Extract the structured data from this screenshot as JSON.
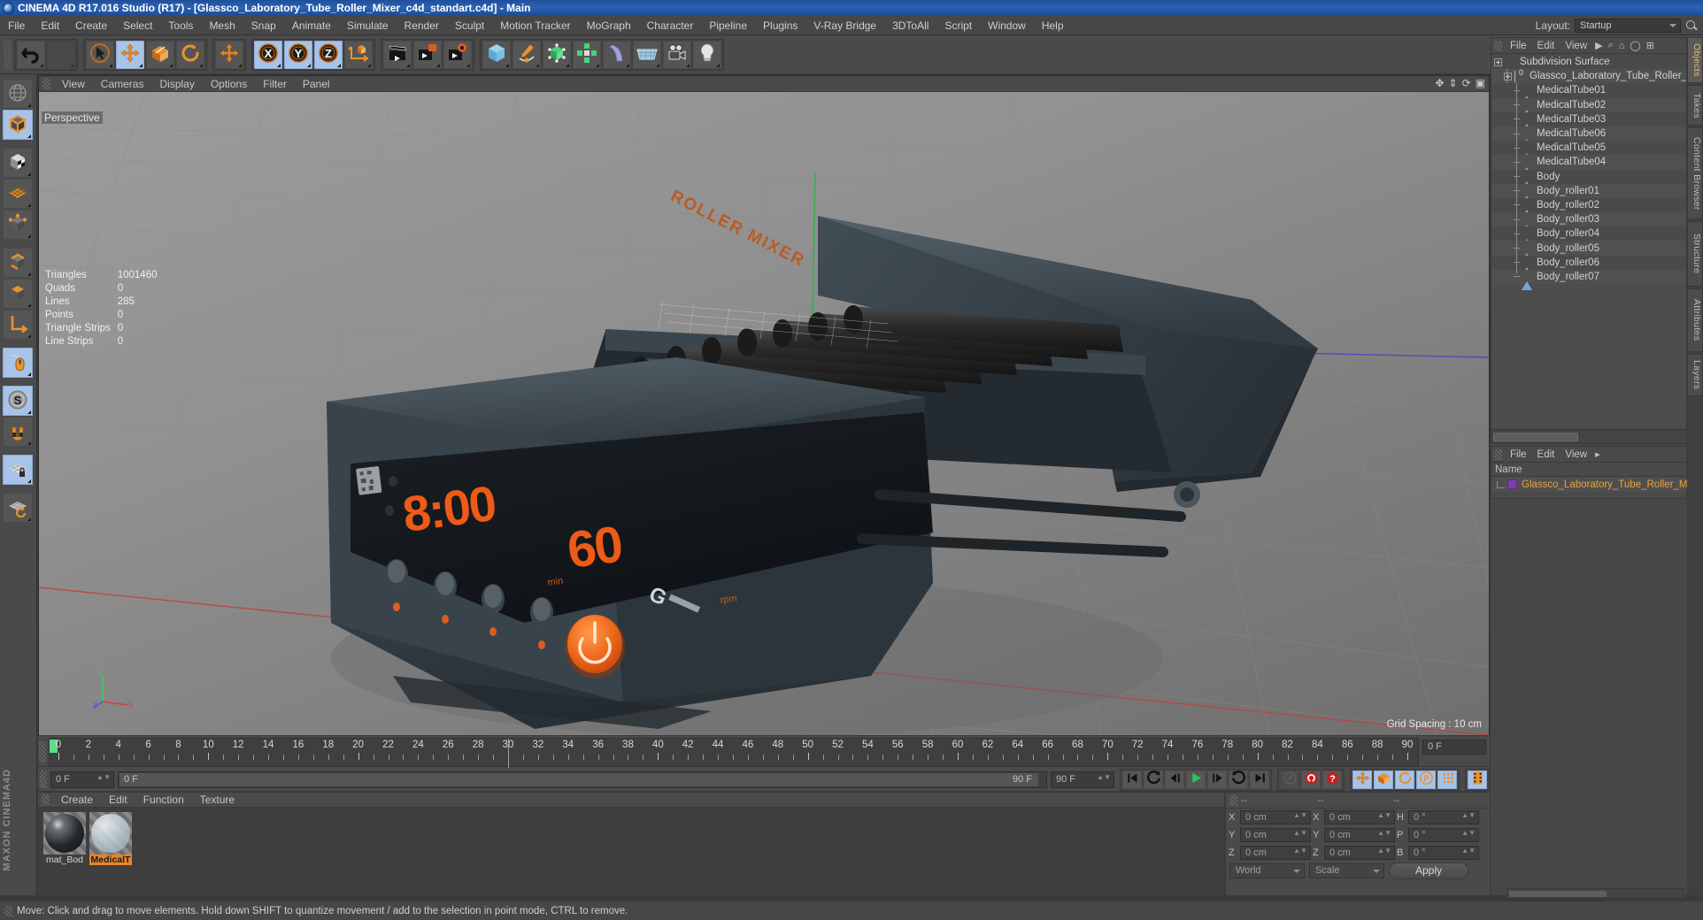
{
  "app": {
    "title": "CINEMA 4D R17.016 Studio (R17) - [Glassco_Laboratory_Tube_Roller_Mixer_c4d_standart.c4d] - Main",
    "logo_icon": "c4d-logo-icon"
  },
  "menubar": {
    "items": [
      "File",
      "Edit",
      "Create",
      "Select",
      "Tools",
      "Mesh",
      "Snap",
      "Animate",
      "Simulate",
      "Render",
      "Sculpt",
      "Motion Tracker",
      "MoGraph",
      "Character",
      "Pipeline",
      "Plugins",
      "V-Ray Bridge",
      "3DToAll",
      "Script",
      "Window",
      "Help"
    ],
    "layout_label": "Layout:",
    "layout_value": "Startup",
    "search_icon": "search-icon"
  },
  "toolbar": {
    "groups": [
      {
        "name": "history",
        "buttons": [
          {
            "name": "undo-button",
            "icon": "undo-arrow-icon",
            "state": "normal"
          },
          {
            "name": "redo-button",
            "icon": "redo-arrow-icon",
            "state": "disabled"
          }
        ]
      },
      {
        "name": "transform",
        "buttons": [
          {
            "name": "live-selection-tool",
            "icon": "cursor-select-icon",
            "state": "normal"
          },
          {
            "name": "move-tool",
            "icon": "move-arrows-icon",
            "state": "active"
          },
          {
            "name": "scale-tool",
            "icon": "scale-box-icon",
            "state": "normal"
          },
          {
            "name": "rotate-tool",
            "icon": "rotate-circle-icon",
            "state": "normal"
          }
        ]
      },
      {
        "name": "move-duplicate",
        "buttons": [
          {
            "name": "move-tool-secondary",
            "icon": "move-arrows-icon",
            "state": "normal"
          }
        ]
      },
      {
        "name": "axis-locks",
        "buttons": [
          {
            "name": "lock-x-axis",
            "icon": "axis-x-icon",
            "state": "active",
            "label": "X"
          },
          {
            "name": "lock-y-axis",
            "icon": "axis-y-icon",
            "state": "active",
            "label": "Y"
          },
          {
            "name": "lock-z-axis",
            "icon": "axis-z-icon",
            "state": "active",
            "label": "Z"
          },
          {
            "name": "world-object-coords",
            "icon": "world-axis-icon",
            "state": "normal"
          }
        ]
      },
      {
        "name": "render",
        "buttons": [
          {
            "name": "render-view-button",
            "icon": "render-clapboard-icon",
            "state": "normal"
          },
          {
            "name": "render-to-picture-viewer",
            "icon": "render-picture-icon",
            "state": "normal"
          },
          {
            "name": "render-settings",
            "icon": "render-gear-icon",
            "state": "normal"
          }
        ]
      },
      {
        "name": "create",
        "buttons": [
          {
            "name": "add-cube-primitive",
            "icon": "cube-icon",
            "state": "normal"
          },
          {
            "name": "add-spline",
            "icon": "pen-spline-icon",
            "state": "normal"
          },
          {
            "name": "add-generator",
            "icon": "generator-cage-icon",
            "state": "normal"
          },
          {
            "name": "add-modeling-object",
            "icon": "array-clone-icon",
            "state": "normal"
          },
          {
            "name": "add-deformer",
            "icon": "bend-deformer-icon",
            "state": "normal"
          },
          {
            "name": "add-environment",
            "icon": "floor-grid-icon",
            "state": "normal"
          },
          {
            "name": "add-camera",
            "icon": "camera-icon",
            "state": "normal"
          },
          {
            "name": "add-light",
            "icon": "light-bulb-icon",
            "state": "normal"
          }
        ]
      }
    ]
  },
  "left_toolbar": {
    "buttons": [
      {
        "name": "undo-view-tool",
        "icon": "globe-wire-icon",
        "state": "normal"
      },
      {
        "name": "make-editable",
        "icon": "make-editable-cube-icon",
        "state": "active"
      },
      {
        "name": "texture-mode",
        "icon": "texture-checker-cube-icon",
        "state": "normal"
      },
      {
        "name": "uv-mesh-mode",
        "icon": "uv-grid-icon",
        "state": "normal"
      },
      {
        "name": "points-mode",
        "icon": "points-cube-icon",
        "state": "normal"
      },
      {
        "name": "edges-mode",
        "icon": "edges-cube-icon",
        "state": "normal"
      },
      {
        "name": "polygons-mode",
        "icon": "polygons-cube-icon",
        "state": "normal"
      },
      {
        "name": "object-axis-mode",
        "icon": "axis-L-icon",
        "state": "normal"
      },
      {
        "name": "enable-snap-mouse",
        "icon": "mouse-icon",
        "state": "active"
      },
      {
        "name": "snap-settings",
        "icon": "snap-S-icon",
        "state": "active"
      },
      {
        "name": "magnet-tool",
        "icon": "magnet-icon",
        "state": "normal"
      },
      {
        "name": "workplane-lock",
        "icon": "workplane-lock-icon",
        "state": "active"
      },
      {
        "name": "workplane-rotate",
        "icon": "workplane-rotate-icon",
        "state": "normal"
      }
    ]
  },
  "viewport": {
    "menu": [
      "View",
      "Cameras",
      "Display",
      "Options",
      "Filter",
      "Panel"
    ],
    "label": "Perspective",
    "grid_spacing": "Grid Spacing : 10 cm",
    "stats": [
      {
        "key": "Triangles",
        "value": "1001460"
      },
      {
        "key": "Quads",
        "value": "0"
      },
      {
        "key": "Lines",
        "value": "285"
      },
      {
        "key": "Points",
        "value": "0"
      },
      {
        "key": "Triangle Strips",
        "value": "0"
      },
      {
        "key": "Line Strips",
        "value": "0"
      }
    ],
    "axis_labels": {
      "x": "X",
      "y": "Y",
      "z": "Z"
    },
    "model": {
      "name": "Laboratory Tube Roller Mixer",
      "display_time": "8:00",
      "display_speed": "60",
      "brand_text": "ROLLER MIXER",
      "power_button": "power-icon",
      "accent_color": "#e8561e",
      "body_color": "#343c42"
    }
  },
  "timeline": {
    "tick_start": 0,
    "tick_end": 90,
    "tick_step": 2,
    "current_frame_label": "0 F",
    "start_field": "0 F",
    "slider_left_label": "0 F",
    "slider_right_label": "90 F",
    "end_field": "90 F",
    "playback_buttons": [
      {
        "name": "go-to-start-button",
        "icon": "skip-start-icon"
      },
      {
        "name": "previous-keyframe-button",
        "icon": "rewind-key-icon"
      },
      {
        "name": "step-back-button",
        "icon": "step-back-icon"
      },
      {
        "name": "play-button",
        "icon": "play-icon"
      },
      {
        "name": "step-forward-button",
        "icon": "step-forward-icon"
      },
      {
        "name": "next-keyframe-button",
        "icon": "forward-key-icon"
      },
      {
        "name": "go-to-end-button",
        "icon": "skip-end-icon"
      }
    ],
    "record_buttons": [
      {
        "name": "autokeying-toggle",
        "icon": "autokey-icon",
        "state": "disabled"
      },
      {
        "name": "record-active-objects",
        "icon": "record-circle-icon",
        "state": "normal"
      },
      {
        "name": "keyframe-selection",
        "icon": "keyframe-question-icon",
        "state": "normal"
      }
    ],
    "key_toggles": [
      {
        "name": "record-position-toggle",
        "icon": "position-arrows-icon",
        "state": "active"
      },
      {
        "name": "record-scale-toggle",
        "icon": "scale-icon",
        "state": "active"
      },
      {
        "name": "record-rotation-toggle",
        "icon": "rotation-icon",
        "state": "active"
      },
      {
        "name": "record-parameter-toggle",
        "icon": "parameter-P-icon",
        "state": "active"
      },
      {
        "name": "point-level-animation-toggle",
        "icon": "pla-dots-icon",
        "state": "active"
      }
    ],
    "extra_button": {
      "name": "timeline-settings-button",
      "icon": "film-strip-icon",
      "state": "active"
    }
  },
  "material_manager": {
    "menu": [
      "Create",
      "Edit",
      "Function",
      "Texture"
    ],
    "materials": [
      {
        "name": "mat_Bod",
        "selected": false,
        "color": "#2b2f33"
      },
      {
        "name": "MedicalT",
        "selected": true,
        "color": "#c9d4d8"
      }
    ]
  },
  "coordinates": {
    "header": [
      "--",
      "--",
      "--"
    ],
    "rows": [
      {
        "axis1": "X",
        "value1": "0 cm",
        "axis2": "X",
        "value2": "0 cm",
        "axis3": "H",
        "value3": "0 °"
      },
      {
        "axis1": "Y",
        "value1": "0 cm",
        "axis2": "Y",
        "value2": "0 cm",
        "axis3": "P",
        "value3": "0 °"
      },
      {
        "axis1": "Z",
        "value1": "0 cm",
        "axis2": "Z",
        "value2": "0 cm",
        "axis3": "B",
        "value3": "0 °"
      }
    ],
    "coord_system": "World",
    "size_mode": "Scale",
    "apply_label": "Apply"
  },
  "object_manager": {
    "menu": [
      "File",
      "Edit",
      "View"
    ],
    "icons": [
      "play-filter-icon",
      "search-icon",
      "home-icon",
      "ellipse-icon",
      "add-layer-icon"
    ],
    "tree": [
      {
        "label": "Subdivision Surface",
        "icon": "subdivision-surface-icon",
        "depth": 0,
        "expander": true
      },
      {
        "label": "Glassco_Laboratory_Tube_Roller_M",
        "icon": "null-object-icon",
        "depth": 1,
        "expander": true
      },
      {
        "label": "MedicalTube01",
        "icon": "polygon-object-icon",
        "depth": 2,
        "expander": false
      },
      {
        "label": "MedicalTube02",
        "icon": "polygon-object-icon",
        "depth": 2,
        "expander": false
      },
      {
        "label": "MedicalTube03",
        "icon": "polygon-object-icon",
        "depth": 2,
        "expander": false
      },
      {
        "label": "MedicalTube06",
        "icon": "polygon-object-icon",
        "depth": 2,
        "expander": false
      },
      {
        "label": "MedicalTube05",
        "icon": "polygon-object-icon",
        "depth": 2,
        "expander": false
      },
      {
        "label": "MedicalTube04",
        "icon": "polygon-object-icon",
        "depth": 2,
        "expander": false
      },
      {
        "label": "Body",
        "icon": "polygon-object-icon",
        "depth": 2,
        "expander": false
      },
      {
        "label": "Body_roller01",
        "icon": "polygon-object-icon",
        "depth": 2,
        "expander": false
      },
      {
        "label": "Body_roller02",
        "icon": "polygon-object-icon",
        "depth": 2,
        "expander": false
      },
      {
        "label": "Body_roller03",
        "icon": "polygon-object-icon",
        "depth": 2,
        "expander": false
      },
      {
        "label": "Body_roller04",
        "icon": "polygon-object-icon",
        "depth": 2,
        "expander": false
      },
      {
        "label": "Body_roller05",
        "icon": "polygon-object-icon",
        "depth": 2,
        "expander": false
      },
      {
        "label": "Body_roller06",
        "icon": "polygon-object-icon",
        "depth": 2,
        "expander": false
      },
      {
        "label": "Body_roller07",
        "icon": "polygon-object-icon",
        "depth": 2,
        "expander": false
      }
    ]
  },
  "layer_manager": {
    "menu": [
      "File",
      "Edit",
      "View"
    ],
    "column_header": "Name",
    "rows": [
      {
        "label": "Glassco_Laboratory_Tube_Roller_Mi",
        "color": "#7a3fa8"
      }
    ]
  },
  "right_tabs": [
    {
      "label": "Objects",
      "active": true
    },
    {
      "label": "Takes",
      "active": false
    },
    {
      "label": "Content Browser",
      "active": false
    },
    {
      "label": "Structure",
      "active": false
    },
    {
      "label": "Attributes",
      "active": false
    },
    {
      "label": "Layers",
      "active": false
    }
  ],
  "status_bar": {
    "text": "Move: Click and drag to move elements. Hold down SHIFT to quantize movement / add to the selection in point mode, CTRL to remove."
  }
}
